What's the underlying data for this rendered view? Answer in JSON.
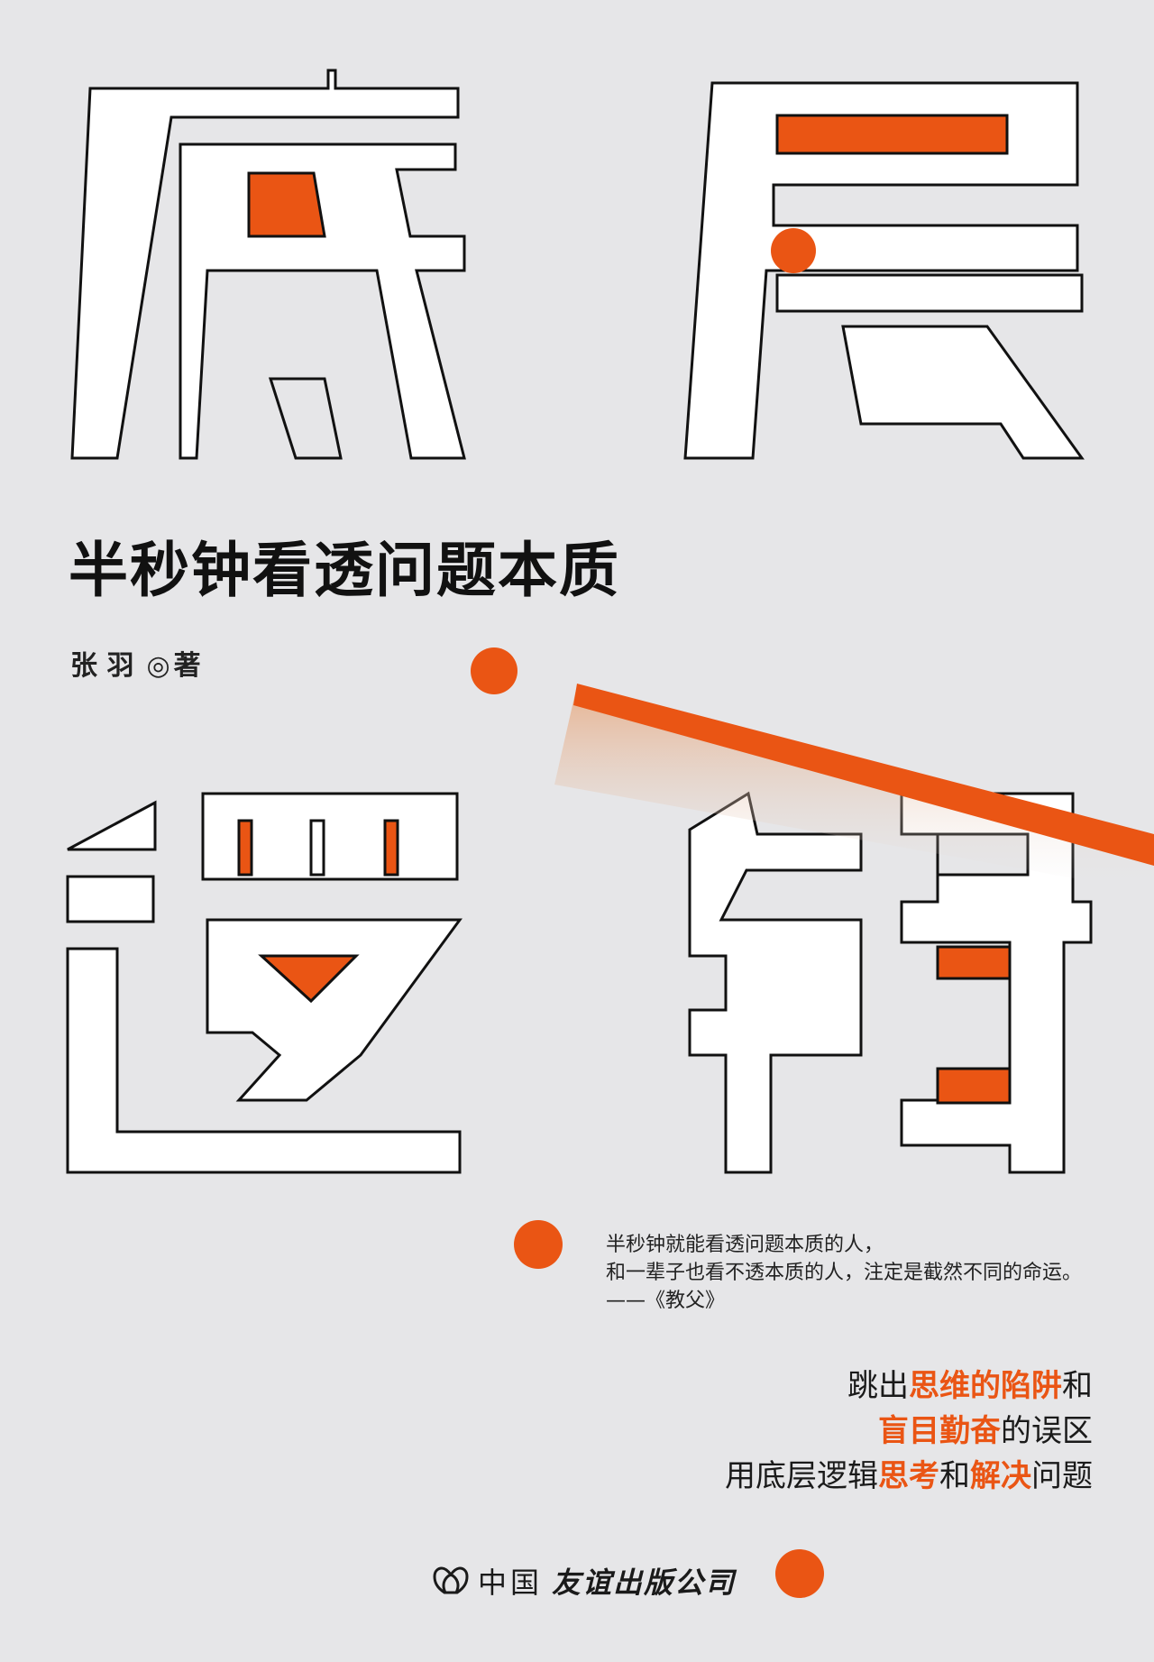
{
  "book": {
    "title_chars": [
      "底",
      "层",
      "逻",
      "辑"
    ],
    "subtitle": "半秒钟看透问题本质",
    "author": "张 羽",
    "author_sep": "◎",
    "author_role": "著"
  },
  "quote": {
    "line1": "半秒钟就能看透问题本质的人，",
    "line2": "和一辈子也看不透本质的人，注定是截然不同的命运。",
    "source": "——《教父》"
  },
  "slogan": {
    "l1_a": "跳出",
    "l1_b": "思维的陷阱",
    "l1_c": "和",
    "l2_a": "盲目勤奋",
    "l2_b": "的误区",
    "l3_a": "用底层逻辑",
    "l3_b": "思考",
    "l3_c": "和",
    "l3_d": "解决",
    "l3_e": "问题"
  },
  "publisher": {
    "name_a": "中国",
    "name_b": "友谊出版公司",
    "logo": "heart-logo-icon"
  },
  "colors": {
    "accent": "#ea5514",
    "background": "#e6e6e8",
    "text": "#111111"
  }
}
